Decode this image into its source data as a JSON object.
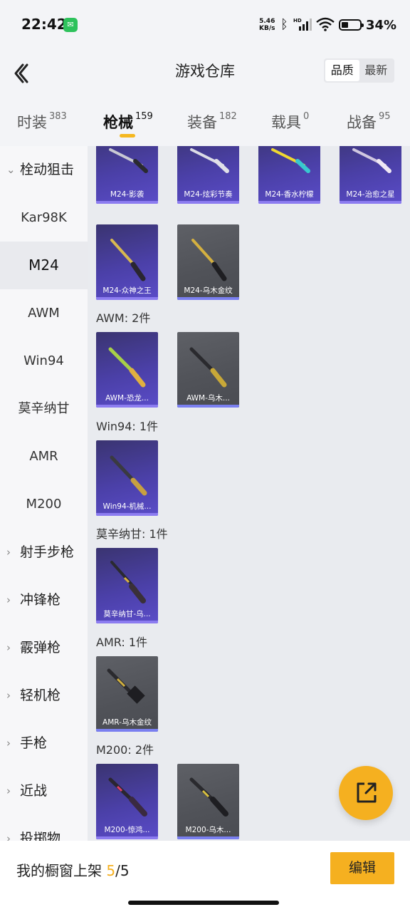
{
  "status_bar": {
    "time": "22:42",
    "net_speed_value": "5.46",
    "net_speed_unit": "KB/s",
    "battery": "34%",
    "hd_label": "HD"
  },
  "header": {
    "title": "游戏仓库",
    "sort_options": [
      "品质",
      "最新"
    ],
    "sort_active": "品质"
  },
  "tabs": [
    {
      "label": "时装",
      "count": "383"
    },
    {
      "label": "枪械",
      "count": "159"
    },
    {
      "label": "装备",
      "count": "182"
    },
    {
      "label": "载具",
      "count": "0"
    },
    {
      "label": "战备",
      "count": "95"
    }
  ],
  "active_tab": "枪械",
  "sidebar": {
    "expanded_category": "栓动狙击",
    "sub_items": [
      "Kar98K",
      "M24",
      "AWM",
      "Win94",
      "莫辛纳甘",
      "AMR",
      "M200"
    ],
    "selected_item": "M24",
    "categories": [
      "射手步枪",
      "冲锋枪",
      "霰弹枪",
      "轻机枪",
      "手枪",
      "近战",
      "投掷物"
    ]
  },
  "content": {
    "m24_items": [
      "M24-影袭",
      "M24-炫彩节奏",
      "M24-香水柠檬",
      "M24-治愈之星",
      "M24-众神之王",
      "M24-乌木金纹"
    ],
    "sections": [
      {
        "heading": "AWM: 2件",
        "items": [
          "AWM-恐龙...",
          "AWM-乌木..."
        ]
      },
      {
        "heading": "Win94: 1件",
        "items": [
          "Win94-机械..."
        ]
      },
      {
        "heading": "莫辛纳甘: 1件",
        "items": [
          "莫辛纳甘-乌..."
        ]
      },
      {
        "heading": "AMR: 1件",
        "items": [
          "AMR-乌木金纹"
        ]
      },
      {
        "heading": "M200: 2件",
        "items": [
          "M200-惊鸿...",
          "M200-乌木..."
        ]
      }
    ]
  },
  "bottom": {
    "shelf_label": "我的橱窗上架",
    "shelf_current": "5",
    "shelf_sep": "/",
    "shelf_total": "5",
    "edit_label": "编辑"
  },
  "colors": {
    "accent": "#f5b020",
    "card_purple": "#4b40a8",
    "card_gray": "#55575d"
  }
}
